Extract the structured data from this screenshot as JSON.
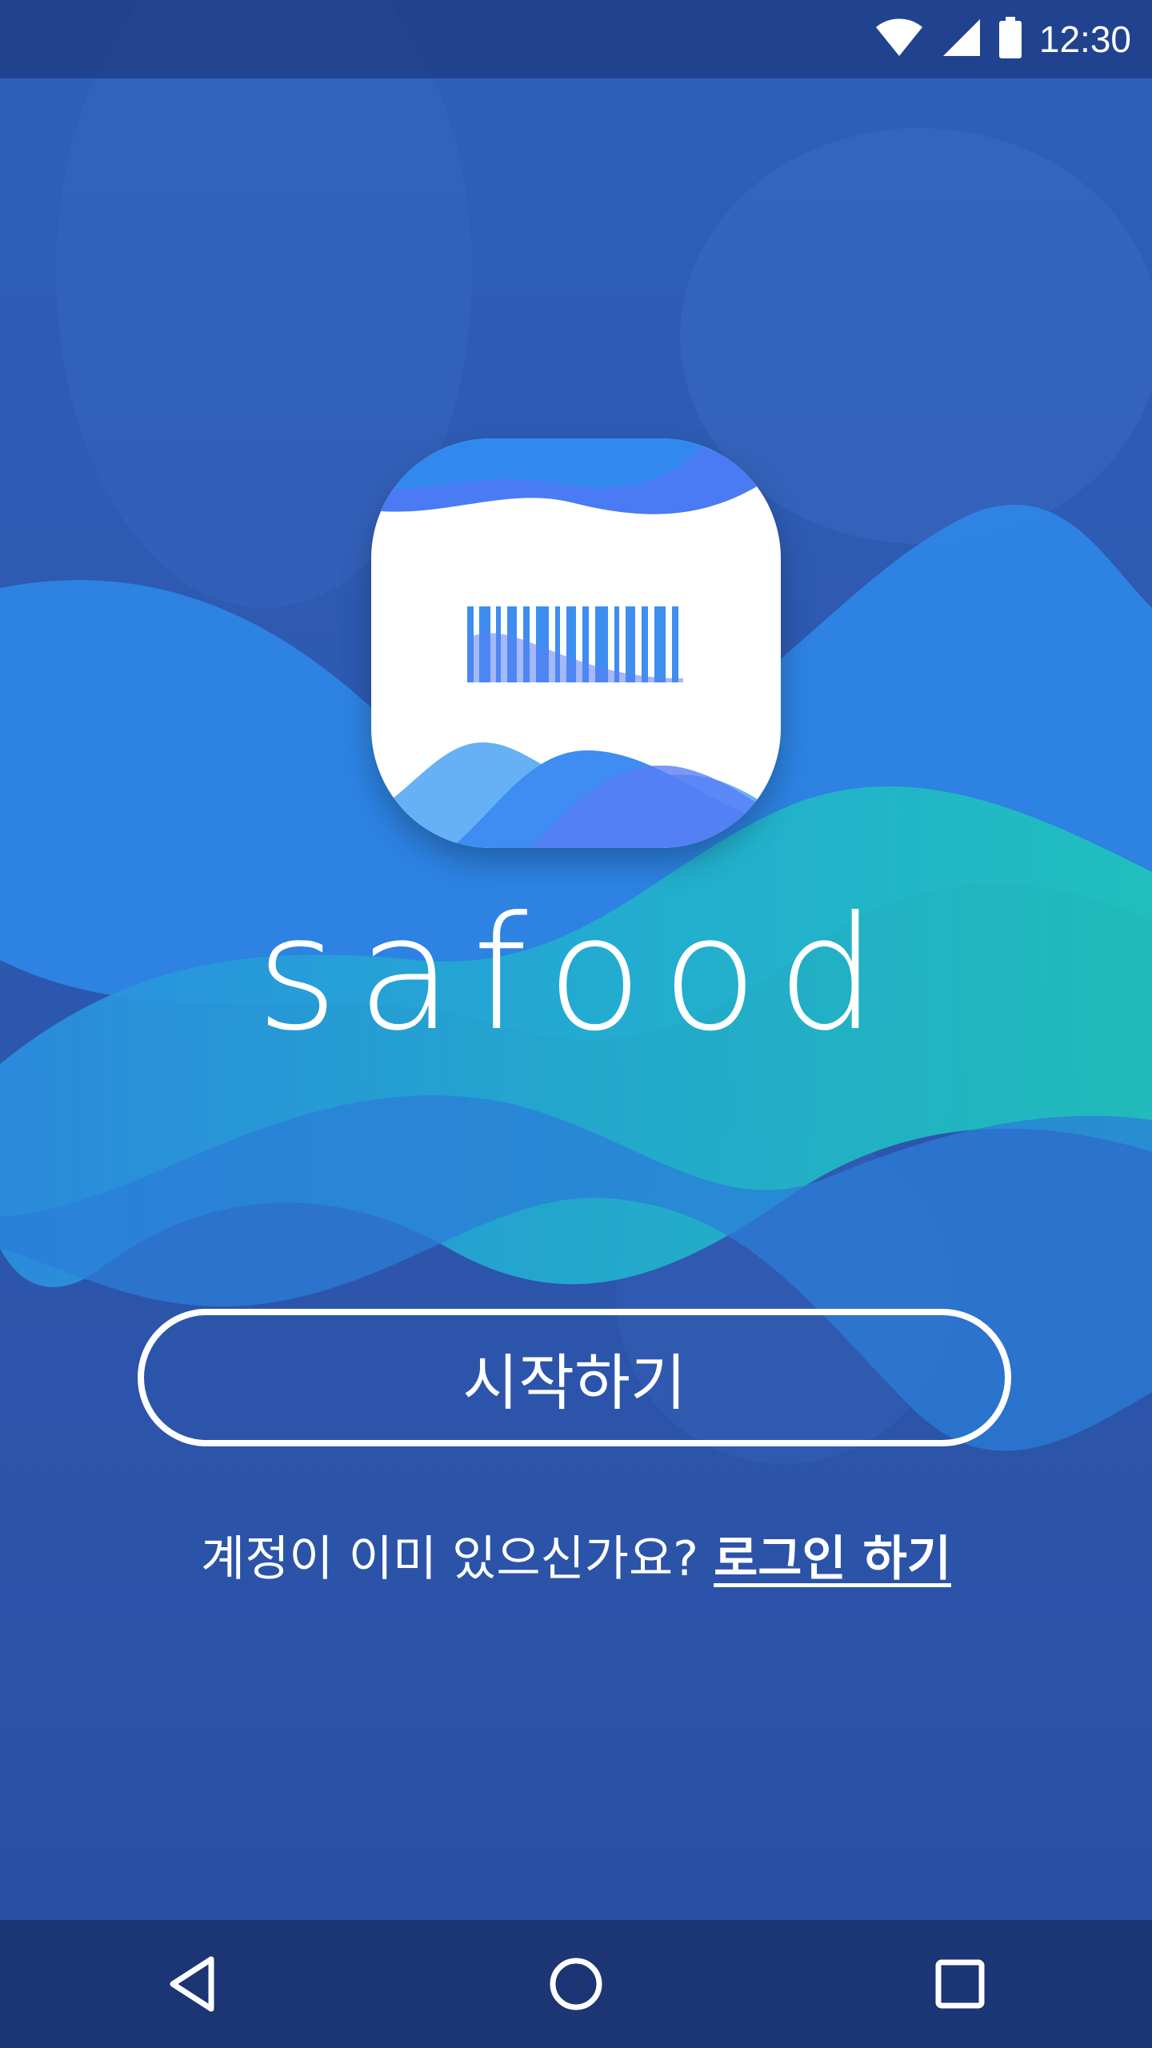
{
  "status_bar": {
    "time": "12:30",
    "icons": [
      "wifi-icon",
      "signal-icon",
      "battery-icon"
    ]
  },
  "app": {
    "name": "safood",
    "logo_icon": "barcode-logo-icon"
  },
  "actions": {
    "start_label": "시작하기",
    "login_prompt": "계정이 이미 있으신가요?",
    "login_link": "로그인 하기"
  },
  "navigation": {
    "buttons": [
      "back-icon",
      "home-icon",
      "recents-icon"
    ]
  },
  "colors": {
    "background": "#2a56ad",
    "wave_blue": "#2e86e6",
    "wave_teal": "#21bdbd",
    "icon_accent": "#4a7bf4",
    "nav_bar": "#1b3575"
  }
}
